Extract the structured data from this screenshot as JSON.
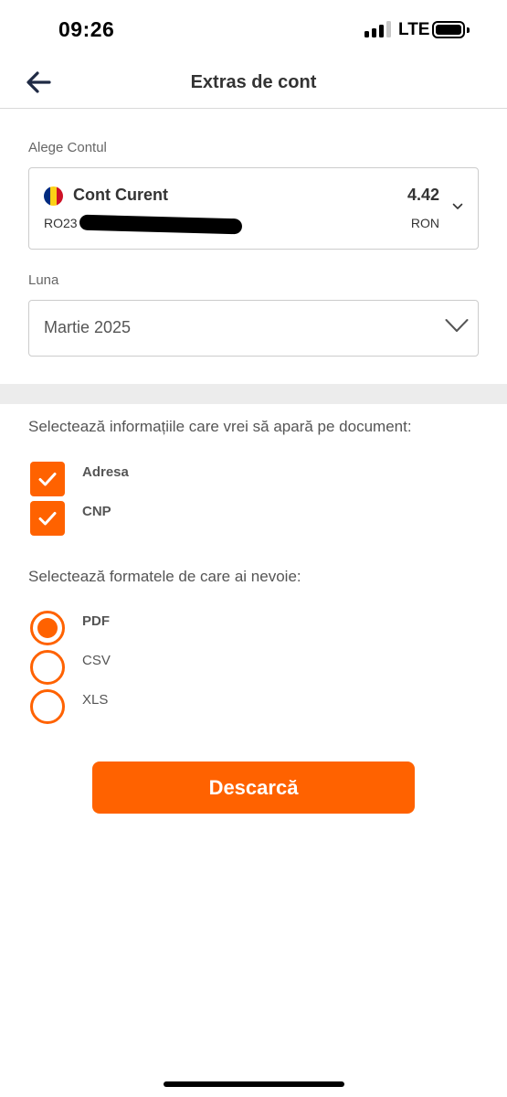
{
  "status_bar": {
    "time": "09:26",
    "network": "LTE",
    "signal_bars_filled": 3,
    "signal_bars_total": 4,
    "battery_level": 1.0
  },
  "header": {
    "title": "Extras de cont",
    "back_icon": "arrow-left-icon"
  },
  "account": {
    "label": "Alege Contul",
    "name": "Cont Curent",
    "balance": "4.42",
    "iban_visible": "RO23",
    "currency": "RON",
    "flag_colors": [
      "#002b7f",
      "#fcd116",
      "#ce1126"
    ],
    "chevron_icon": "chevron-down-icon"
  },
  "month": {
    "label": "Luna",
    "value": "Martie 2025",
    "chevron_icon": "chevron-down-icon"
  },
  "info_section": {
    "heading": "Selectează informațiile care vrei să apară pe document:",
    "options": [
      {
        "label": "Adresa",
        "checked": true
      },
      {
        "label": "CNP",
        "checked": true
      }
    ]
  },
  "format_section": {
    "heading": "Selectează formatele de care ai nevoie:",
    "options": [
      {
        "label": "PDF",
        "selected": true
      },
      {
        "label": "CSV",
        "selected": false
      },
      {
        "label": "XLS",
        "selected": false
      }
    ]
  },
  "download_button": {
    "label": "Descarcă"
  },
  "colors": {
    "accent": "#ff6200",
    "border": "#cccccc",
    "divider": "#ececec"
  }
}
